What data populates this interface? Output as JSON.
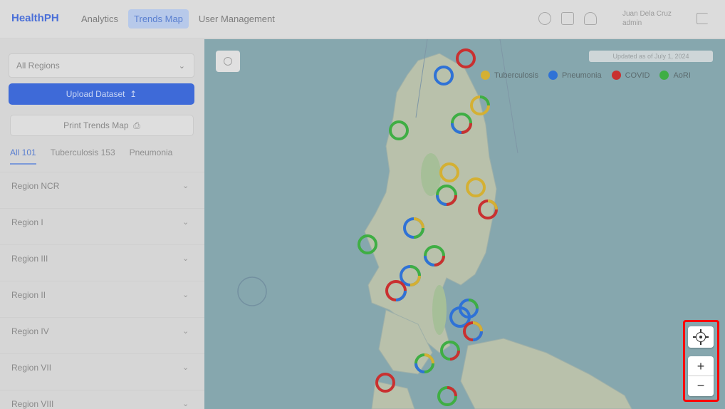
{
  "app": {
    "brand": "HealthPH"
  },
  "nav": [
    {
      "label": "Analytics",
      "active": false
    },
    {
      "label": "Trends Map",
      "active": true
    },
    {
      "label": "User Management",
      "active": false
    }
  ],
  "user": {
    "name": "Juan Dela Cruz",
    "role": "admin"
  },
  "sidebar": {
    "region_select": "All Regions",
    "upload_label": "Upload Dataset",
    "print_label": "Print Trends Map",
    "tabs": [
      {
        "label": "All 101",
        "active": true
      },
      {
        "label": "Tuberculosis 153",
        "active": false
      },
      {
        "label": "Pneumonia",
        "active": false
      }
    ],
    "regions": [
      "Region NCR",
      "Region I",
      "Region III",
      "Region II",
      "Region IV",
      "Region VII",
      "Region VIII"
    ]
  },
  "map": {
    "updated_text": "Updated as of July 1, 2024",
    "legend": [
      {
        "label": "Tuberculosis",
        "color": "#d4b033"
      },
      {
        "label": "Pneumonia",
        "color": "#2f72d6"
      },
      {
        "label": "COVID",
        "color": "#c93030"
      },
      {
        "label": "AoRI",
        "color": "#3fae44"
      }
    ],
    "controls": {
      "locate_icon": "crosshair-locate-icon",
      "zoom_in": "+",
      "zoom_out": "−"
    }
  }
}
